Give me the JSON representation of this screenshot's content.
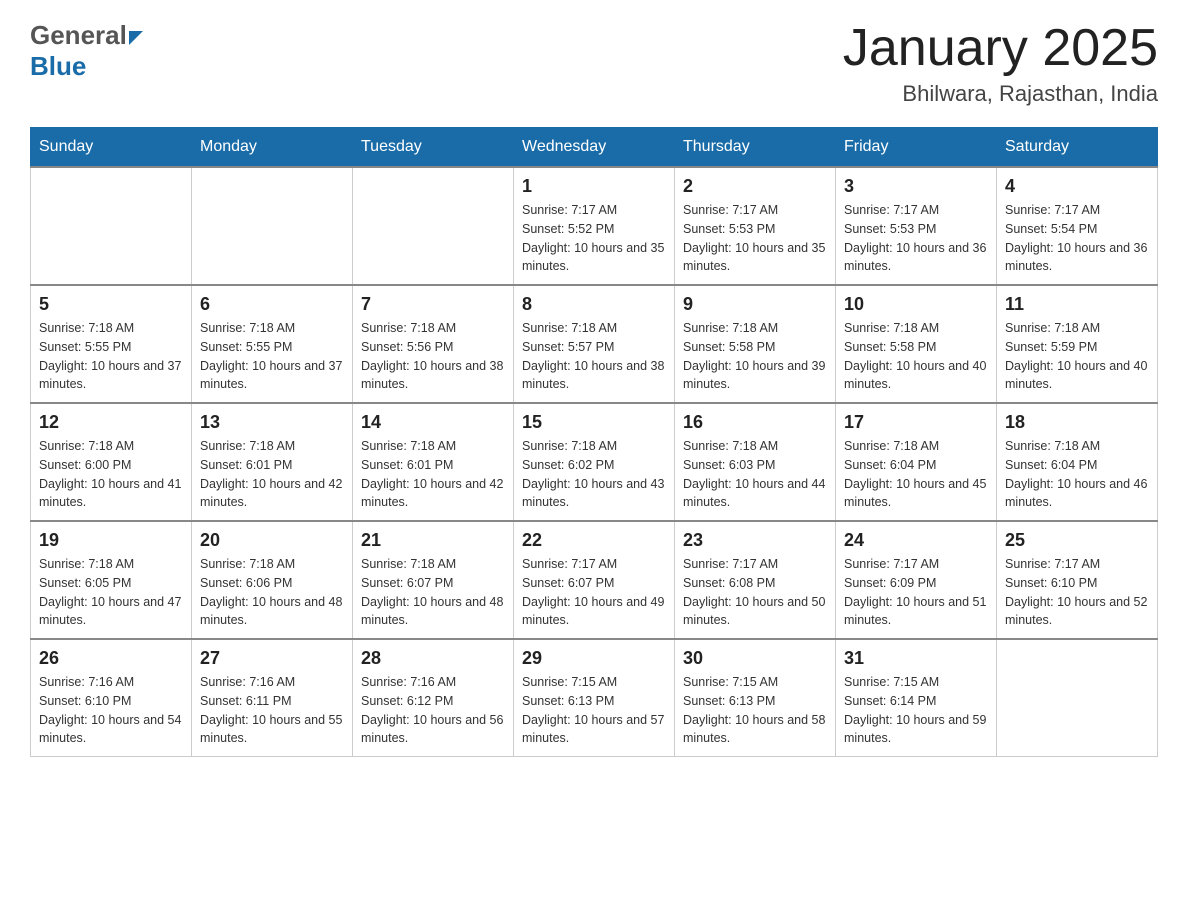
{
  "header": {
    "logo_general": "General",
    "logo_blue": "Blue",
    "month_title": "January 2025",
    "location": "Bhilwara, Rajasthan, India"
  },
  "days_of_week": [
    "Sunday",
    "Monday",
    "Tuesday",
    "Wednesday",
    "Thursday",
    "Friday",
    "Saturday"
  ],
  "weeks": [
    [
      {
        "day": "",
        "sunrise": "",
        "sunset": "",
        "daylight": ""
      },
      {
        "day": "",
        "sunrise": "",
        "sunset": "",
        "daylight": ""
      },
      {
        "day": "",
        "sunrise": "",
        "sunset": "",
        "daylight": ""
      },
      {
        "day": "1",
        "sunrise": "Sunrise: 7:17 AM",
        "sunset": "Sunset: 5:52 PM",
        "daylight": "Daylight: 10 hours and 35 minutes."
      },
      {
        "day": "2",
        "sunrise": "Sunrise: 7:17 AM",
        "sunset": "Sunset: 5:53 PM",
        "daylight": "Daylight: 10 hours and 35 minutes."
      },
      {
        "day": "3",
        "sunrise": "Sunrise: 7:17 AM",
        "sunset": "Sunset: 5:53 PM",
        "daylight": "Daylight: 10 hours and 36 minutes."
      },
      {
        "day": "4",
        "sunrise": "Sunrise: 7:17 AM",
        "sunset": "Sunset: 5:54 PM",
        "daylight": "Daylight: 10 hours and 36 minutes."
      }
    ],
    [
      {
        "day": "5",
        "sunrise": "Sunrise: 7:18 AM",
        "sunset": "Sunset: 5:55 PM",
        "daylight": "Daylight: 10 hours and 37 minutes."
      },
      {
        "day": "6",
        "sunrise": "Sunrise: 7:18 AM",
        "sunset": "Sunset: 5:55 PM",
        "daylight": "Daylight: 10 hours and 37 minutes."
      },
      {
        "day": "7",
        "sunrise": "Sunrise: 7:18 AM",
        "sunset": "Sunset: 5:56 PM",
        "daylight": "Daylight: 10 hours and 38 minutes."
      },
      {
        "day": "8",
        "sunrise": "Sunrise: 7:18 AM",
        "sunset": "Sunset: 5:57 PM",
        "daylight": "Daylight: 10 hours and 38 minutes."
      },
      {
        "day": "9",
        "sunrise": "Sunrise: 7:18 AM",
        "sunset": "Sunset: 5:58 PM",
        "daylight": "Daylight: 10 hours and 39 minutes."
      },
      {
        "day": "10",
        "sunrise": "Sunrise: 7:18 AM",
        "sunset": "Sunset: 5:58 PM",
        "daylight": "Daylight: 10 hours and 40 minutes."
      },
      {
        "day": "11",
        "sunrise": "Sunrise: 7:18 AM",
        "sunset": "Sunset: 5:59 PM",
        "daylight": "Daylight: 10 hours and 40 minutes."
      }
    ],
    [
      {
        "day": "12",
        "sunrise": "Sunrise: 7:18 AM",
        "sunset": "Sunset: 6:00 PM",
        "daylight": "Daylight: 10 hours and 41 minutes."
      },
      {
        "day": "13",
        "sunrise": "Sunrise: 7:18 AM",
        "sunset": "Sunset: 6:01 PM",
        "daylight": "Daylight: 10 hours and 42 minutes."
      },
      {
        "day": "14",
        "sunrise": "Sunrise: 7:18 AM",
        "sunset": "Sunset: 6:01 PM",
        "daylight": "Daylight: 10 hours and 42 minutes."
      },
      {
        "day": "15",
        "sunrise": "Sunrise: 7:18 AM",
        "sunset": "Sunset: 6:02 PM",
        "daylight": "Daylight: 10 hours and 43 minutes."
      },
      {
        "day": "16",
        "sunrise": "Sunrise: 7:18 AM",
        "sunset": "Sunset: 6:03 PM",
        "daylight": "Daylight: 10 hours and 44 minutes."
      },
      {
        "day": "17",
        "sunrise": "Sunrise: 7:18 AM",
        "sunset": "Sunset: 6:04 PM",
        "daylight": "Daylight: 10 hours and 45 minutes."
      },
      {
        "day": "18",
        "sunrise": "Sunrise: 7:18 AM",
        "sunset": "Sunset: 6:04 PM",
        "daylight": "Daylight: 10 hours and 46 minutes."
      }
    ],
    [
      {
        "day": "19",
        "sunrise": "Sunrise: 7:18 AM",
        "sunset": "Sunset: 6:05 PM",
        "daylight": "Daylight: 10 hours and 47 minutes."
      },
      {
        "day": "20",
        "sunrise": "Sunrise: 7:18 AM",
        "sunset": "Sunset: 6:06 PM",
        "daylight": "Daylight: 10 hours and 48 minutes."
      },
      {
        "day": "21",
        "sunrise": "Sunrise: 7:18 AM",
        "sunset": "Sunset: 6:07 PM",
        "daylight": "Daylight: 10 hours and 48 minutes."
      },
      {
        "day": "22",
        "sunrise": "Sunrise: 7:17 AM",
        "sunset": "Sunset: 6:07 PM",
        "daylight": "Daylight: 10 hours and 49 minutes."
      },
      {
        "day": "23",
        "sunrise": "Sunrise: 7:17 AM",
        "sunset": "Sunset: 6:08 PM",
        "daylight": "Daylight: 10 hours and 50 minutes."
      },
      {
        "day": "24",
        "sunrise": "Sunrise: 7:17 AM",
        "sunset": "Sunset: 6:09 PM",
        "daylight": "Daylight: 10 hours and 51 minutes."
      },
      {
        "day": "25",
        "sunrise": "Sunrise: 7:17 AM",
        "sunset": "Sunset: 6:10 PM",
        "daylight": "Daylight: 10 hours and 52 minutes."
      }
    ],
    [
      {
        "day": "26",
        "sunrise": "Sunrise: 7:16 AM",
        "sunset": "Sunset: 6:10 PM",
        "daylight": "Daylight: 10 hours and 54 minutes."
      },
      {
        "day": "27",
        "sunrise": "Sunrise: 7:16 AM",
        "sunset": "Sunset: 6:11 PM",
        "daylight": "Daylight: 10 hours and 55 minutes."
      },
      {
        "day": "28",
        "sunrise": "Sunrise: 7:16 AM",
        "sunset": "Sunset: 6:12 PM",
        "daylight": "Daylight: 10 hours and 56 minutes."
      },
      {
        "day": "29",
        "sunrise": "Sunrise: 7:15 AM",
        "sunset": "Sunset: 6:13 PM",
        "daylight": "Daylight: 10 hours and 57 minutes."
      },
      {
        "day": "30",
        "sunrise": "Sunrise: 7:15 AM",
        "sunset": "Sunset: 6:13 PM",
        "daylight": "Daylight: 10 hours and 58 minutes."
      },
      {
        "day": "31",
        "sunrise": "Sunrise: 7:15 AM",
        "sunset": "Sunset: 6:14 PM",
        "daylight": "Daylight: 10 hours and 59 minutes."
      },
      {
        "day": "",
        "sunrise": "",
        "sunset": "",
        "daylight": ""
      }
    ]
  ]
}
